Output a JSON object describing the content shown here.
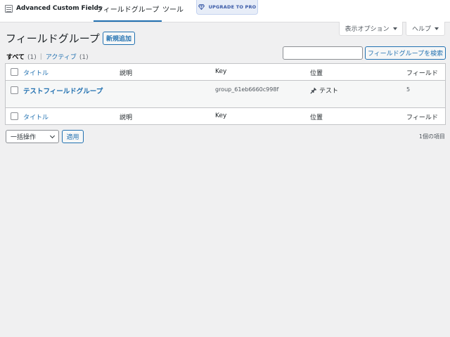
{
  "topbar": {
    "brand_name": "Advanced Custom Fields",
    "tabs": [
      {
        "label": "フィールドグループ",
        "active": true
      },
      {
        "label": "ツール",
        "active": false
      }
    ],
    "upgrade_label": "UPGRADE TO PRO",
    "accent_color": "#2271b1"
  },
  "screen_meta": {
    "display_options": "表示オプション",
    "help": "ヘルプ"
  },
  "page": {
    "title": "フィールドグループ",
    "add_new": "新規追加"
  },
  "filters": {
    "all_label": "すべて",
    "all_count": "(1)",
    "active_label": "アクティブ",
    "active_count": "(1)",
    "separator": "|"
  },
  "search": {
    "placeholder": "",
    "button": "フィールドグループを検索"
  },
  "table": {
    "columns": [
      "タイトル",
      "説明",
      "Key",
      "位置",
      "フィールド"
    ],
    "rows": [
      {
        "title": "テストフィールドグループ",
        "description": "",
        "key": "group_61eb6660c998f",
        "location": "テスト",
        "fields": "5"
      }
    ]
  },
  "bulk": {
    "selected": "一括操作",
    "apply": "適用",
    "items": "1個の項目"
  },
  "icons": {
    "brand": "acf-logo-icon",
    "upgrade": "diamond-icon",
    "location": "pin-icon"
  }
}
